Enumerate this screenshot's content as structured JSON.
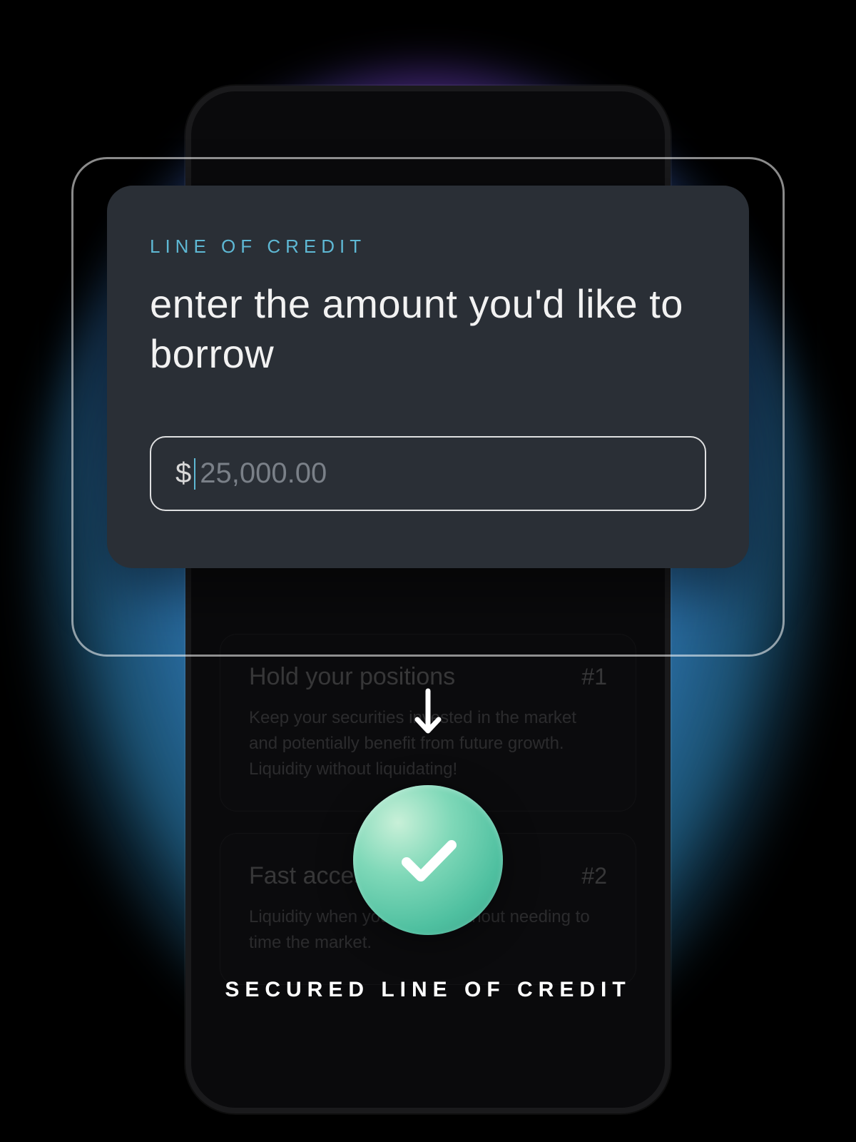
{
  "modal": {
    "eyebrow": "LINE OF CREDIT",
    "title": "enter the amount you'd like to borrow",
    "currency_symbol": "$",
    "placeholder": "25,000.00"
  },
  "confirmation": {
    "label": "SECURED LINE OF CREDIT"
  },
  "background_features": [
    {
      "title": "Hold your positions",
      "number": "#1",
      "body": "Keep your securities invested in the market and potentially benefit from future growth. Liquidity without liquidating!"
    },
    {
      "title": "Fast access to cash",
      "number": "#2",
      "body": "Liquidity when you need it without needing to time the market."
    }
  ],
  "icons": {
    "arrow_down": "arrow-down",
    "checkmark": "checkmark"
  },
  "colors": {
    "accent_cyan": "#5eb8d4",
    "card_bg": "#2a2f36",
    "success_green": "#5fc8a8"
  }
}
